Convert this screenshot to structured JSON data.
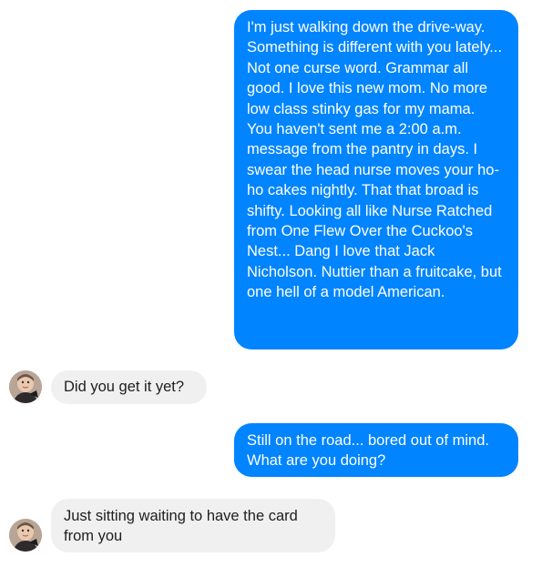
{
  "conversation": {
    "messages": [
      {
        "direction": "outgoing",
        "text": "I'm just walking down the drive-way. Something is different with you lately... Not one curse word. Grammar all good. I love this new mom. No more low class stinky gas for my mama.\nYou haven't sent me a 2:00 a.m. message from the pantry in days. I swear the head nurse moves your ho-ho cakes nightly. That that broad is shifty. Looking all like Nurse Ratched from One Flew Over the Cuckoo's Nest... Dang I love that Jack Nicholson. Nuttier than a fruitcake, but one hell of a model American."
      },
      {
        "direction": "incoming",
        "text": "Did you get it yet?"
      },
      {
        "direction": "outgoing",
        "text": "Still on the road... bored out of mind. What are you doing?"
      },
      {
        "direction": "incoming",
        "text": "Just sitting waiting to have the card from you"
      }
    ]
  },
  "colors": {
    "outgoing_bubble": "#0084ff",
    "incoming_bubble": "#f0f0f0",
    "outgoing_text": "#ffffff",
    "incoming_text": "#1c1e21"
  },
  "icons": {
    "contact_avatar": "contact-avatar-photo"
  }
}
